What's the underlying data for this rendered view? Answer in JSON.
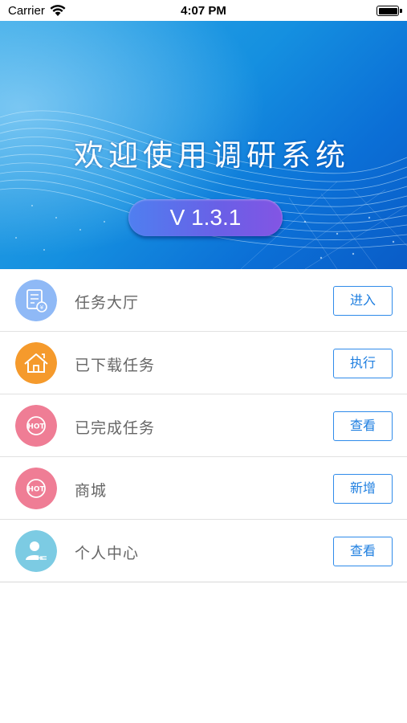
{
  "status_bar": {
    "carrier": "Carrier",
    "time": "4:07 PM"
  },
  "banner": {
    "title": "欢迎使用调研系统",
    "version": "V 1.3.1"
  },
  "menu": [
    {
      "label": "任务大厅",
      "button": "进入",
      "icon": "task-hall-icon",
      "color": "#8fb9f6"
    },
    {
      "label": "已下载任务",
      "button": "执行",
      "icon": "house-icon",
      "color": "#f59a2c"
    },
    {
      "label": "已完成任务",
      "button": "查看",
      "icon": "hot-icon",
      "color": "#ef7d95"
    },
    {
      "label": "商城",
      "button": "新增",
      "icon": "hot-icon",
      "color": "#ef7d95"
    },
    {
      "label": "个人中心",
      "button": "查看",
      "icon": "person-icon",
      "color": "#7ccbe3"
    }
  ],
  "colors": {
    "accent": "#2f8bea",
    "banner": "#1590e0",
    "pill": "#6a5fe6"
  }
}
